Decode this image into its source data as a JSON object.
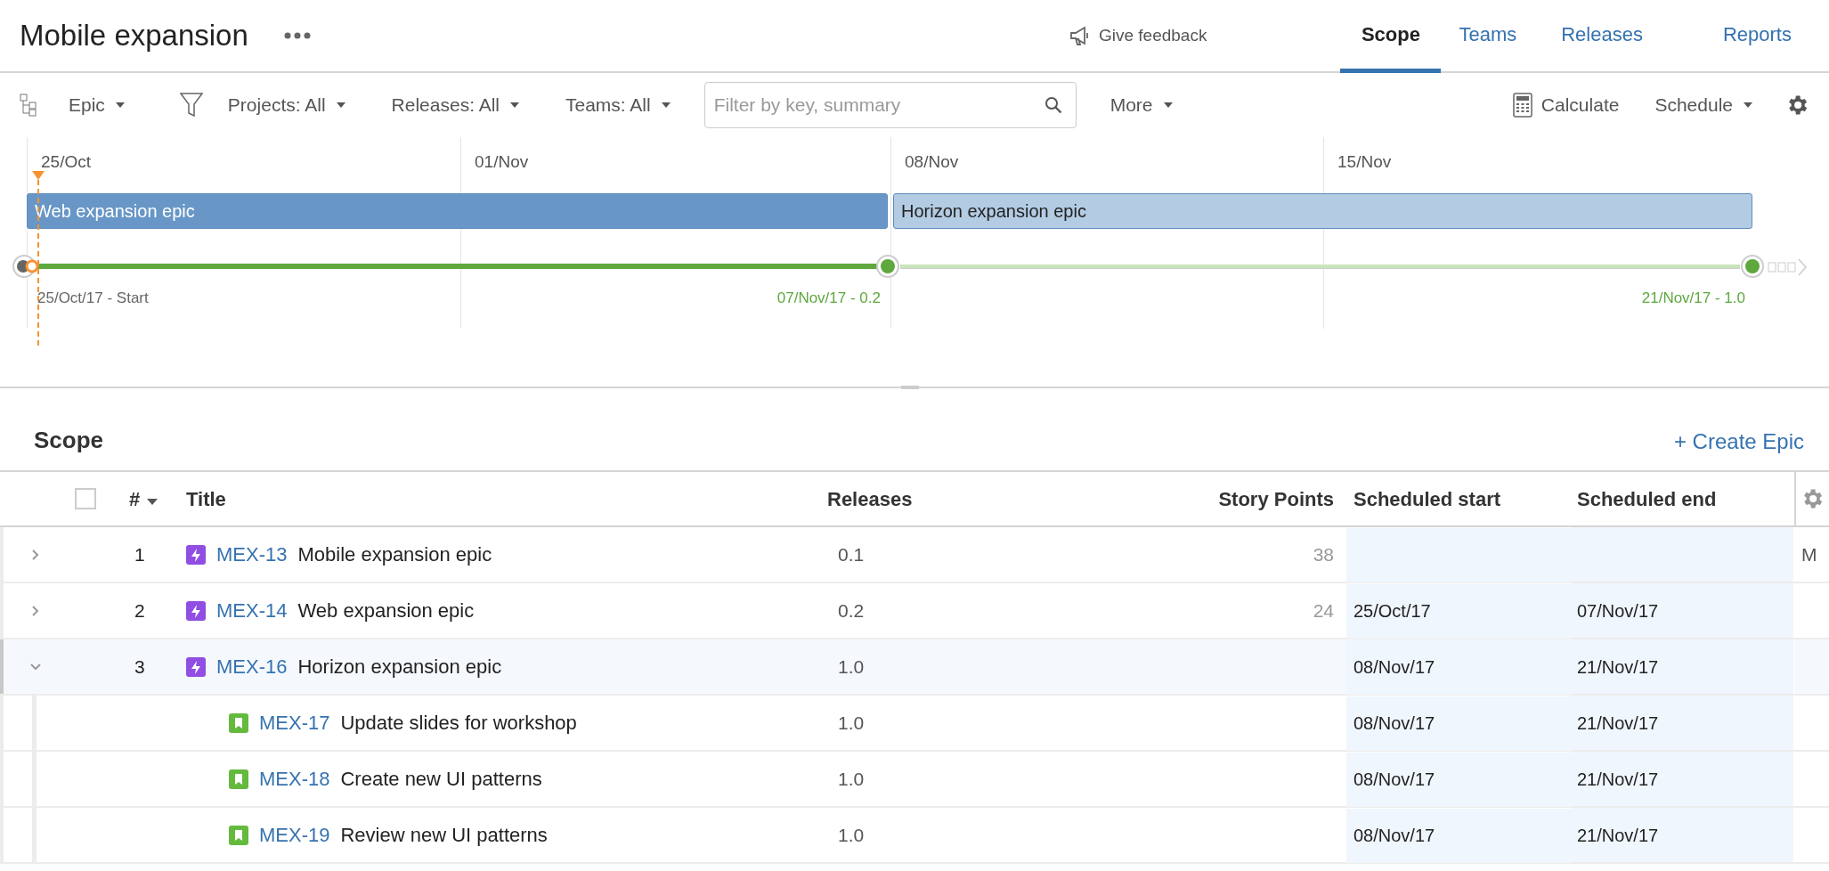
{
  "header": {
    "title": "Mobile expansion",
    "feedback": "Give feedback",
    "tabs": [
      {
        "label": "Scope",
        "selected": true
      },
      {
        "label": "Teams",
        "selected": false
      },
      {
        "label": "Releases",
        "selected": false
      },
      {
        "label": "Reports",
        "selected": false
      }
    ]
  },
  "toolbar": {
    "hierarchy": "Epic",
    "filters": [
      "Projects: All",
      "Releases: All",
      "Teams: All"
    ],
    "search": {
      "placeholder": "Filter by key, summary"
    },
    "more": "More",
    "calculate": "Calculate",
    "schedule": "Schedule"
  },
  "timeline": {
    "ticks": [
      "25/Oct",
      "01/Nov",
      "08/Nov",
      "15/Nov"
    ],
    "bars": [
      {
        "label": "Web expansion epic",
        "selected": true
      },
      {
        "label": "Horizon expansion epic",
        "selected": false
      }
    ],
    "milestones": [
      {
        "kind": "start",
        "label": "25/Oct/17 - Start"
      },
      {
        "kind": "release",
        "label": "07/Nov/17 - 0.2"
      },
      {
        "kind": "release",
        "label": "21/Nov/17 - 1.0"
      }
    ]
  },
  "scope": {
    "title": "Scope",
    "create": "+ Create Epic",
    "columns": [
      "#",
      "Title",
      "Releases",
      "Story Points",
      "Scheduled start",
      "Scheduled end"
    ],
    "select_all": {
      "checked": false
    },
    "rows": [
      {
        "num": "1",
        "key": "MEX-13",
        "title": "Mobile expansion epic",
        "release": "0.1",
        "points": "38",
        "overflow": "M",
        "expanded": false,
        "selected": false
      },
      {
        "num": "2",
        "key": "MEX-14",
        "title": "Web expansion epic",
        "release": "0.2",
        "points": "24",
        "start": "25/Oct/17",
        "end": "07/Nov/17",
        "expanded": false,
        "selected": false
      },
      {
        "num": "3",
        "key": "MEX-16",
        "title": "Horizon expansion epic",
        "release": "1.0",
        "start": "08/Nov/17",
        "end": "21/Nov/17",
        "expanded": true,
        "selected": true,
        "children": [
          {
            "key": "MEX-17",
            "title": "Update slides for workshop",
            "release": "1.0",
            "start": "08/Nov/17",
            "end": "21/Nov/17"
          },
          {
            "key": "MEX-18",
            "title": "Create new UI patterns",
            "release": "1.0",
            "start": "08/Nov/17",
            "end": "21/Nov/17"
          },
          {
            "key": "MEX-19",
            "title": "Review new UI patterns",
            "release": "1.0",
            "start": "08/Nov/17",
            "end": "21/Nov/17"
          }
        ]
      }
    ]
  }
}
